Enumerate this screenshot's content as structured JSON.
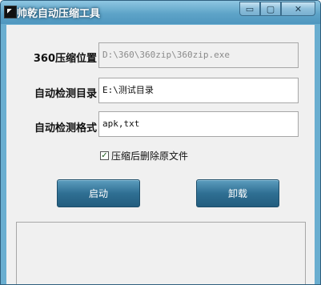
{
  "window": {
    "title": "帅乾自动压缩工具",
    "controls": {
      "minimize": "▭",
      "maximize": "▢",
      "close": "✕"
    }
  },
  "form": {
    "zip_path_label": "360压缩位置",
    "zip_path_value": "D:\\360\\360zip\\360zip.exe",
    "watch_dir_label": "自动检测目录",
    "watch_dir_value": "E:\\测试目录",
    "watch_format_label": "自动检测格式",
    "watch_format_value": "apk,txt",
    "delete_original_label": "压缩后删除原文件",
    "delete_original_checked": "✓"
  },
  "buttons": {
    "start": "启动",
    "uninstall": "卸载"
  },
  "log": {
    "content": ""
  },
  "colors": {
    "titlebar": "#5ea4c8",
    "button": "#2f6f93",
    "client": "#f0f0f0"
  }
}
